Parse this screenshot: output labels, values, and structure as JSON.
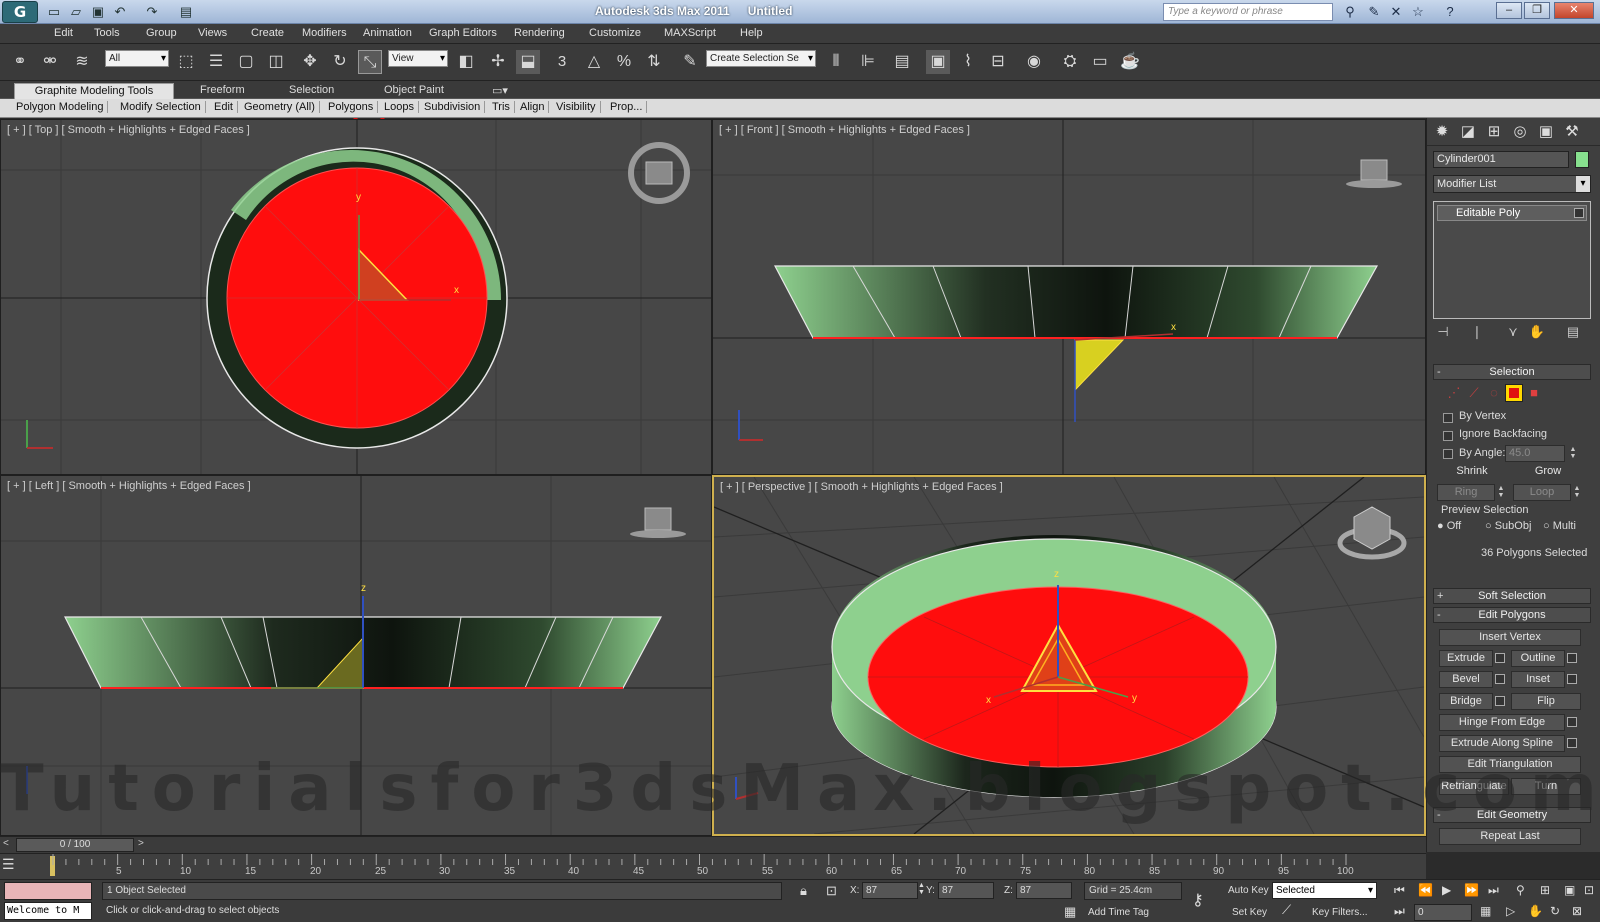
{
  "window": {
    "app_name": "Autodesk 3ds Max  2011",
    "doc_name": "Untitled",
    "search_placeholder": "Type a keyword or phrase"
  },
  "menu": [
    "Edit",
    "Tools",
    "Group",
    "Views",
    "Create",
    "Modifiers",
    "Animation",
    "Graph Editors",
    "Rendering",
    "Customize",
    "MAXScript",
    "Help"
  ],
  "toolbar": {
    "selection_filter": "All",
    "ref_coord": "View",
    "named_selection": "Create Selection Se",
    "snap_label": "3",
    "highlighted_tool": "scale-tool"
  },
  "ribbon": {
    "tabs": [
      "Graphite Modeling Tools",
      "Freeform",
      "Selection",
      "Object Paint"
    ],
    "sub": [
      "Polygon Modeling",
      "Modify Selection",
      "Edit",
      "Geometry (All)",
      "Polygons",
      "Loops",
      "Subdivision",
      "Tris",
      "Align",
      "Visibility",
      "Prop..."
    ]
  },
  "viewports": {
    "top": "[ + ] [ Top ] [ Smooth + Highlights + Edged Faces ]",
    "front": "[ + ] [ Front ] [ Smooth + Highlights + Edged Faces ]",
    "left": "[ + ] [ Left ] [ Smooth + Highlights + Edged Faces ]",
    "perspective": "[ + ] [ Perspective ] [ Smooth + Highlights + Edged Faces ]"
  },
  "command_panel": {
    "object_name": "Cylinder001",
    "object_color": "#87e08e",
    "modifier_list": "Modifier List",
    "stack_item": "Editable Poly",
    "selection": {
      "title": "Selection",
      "by_vertex": "By Vertex",
      "ignore_backfacing": "Ignore Backfacing",
      "by_angle": "By Angle:",
      "angle_value": "45.0",
      "shrink": "Shrink",
      "grow": "Grow",
      "ring": "Ring",
      "loop": "Loop",
      "preview": "Preview Selection",
      "off": "Off",
      "subobj": "SubObj",
      "multi": "Multi",
      "status": "36 Polygons Selected"
    },
    "soft_selection": "Soft Selection",
    "edit_polygons": {
      "title": "Edit Polygons",
      "insert_vertex": "Insert Vertex",
      "extrude": "Extrude",
      "outline": "Outline",
      "bevel": "Bevel",
      "inset": "Inset",
      "bridge": "Bridge",
      "flip": "Flip",
      "hinge": "Hinge From Edge",
      "extrude_spline": "Extrude Along Spline",
      "edit_tri": "Edit Triangulation",
      "retriangulate": "Retriangulate",
      "turn": "Turn"
    },
    "edit_geometry": "Edit Geometry",
    "repeat_last": "Repeat Last"
  },
  "timeline": {
    "slider": "0 / 100",
    "ticks": [
      "5",
      "10",
      "15",
      "20",
      "25",
      "30",
      "35",
      "40",
      "45",
      "50",
      "55",
      "60",
      "65",
      "70",
      "75",
      "80",
      "85",
      "90",
      "95",
      "100"
    ]
  },
  "status": {
    "selected": "1 Object Selected",
    "prompt": "Click or click-and-drag to select objects",
    "maxscript": "Welcome to M",
    "x_label": "X:",
    "x_value": "87",
    "y_label": "Y:",
    "y_value": "87",
    "z_label": "Z:",
    "z_value": "87",
    "grid": "Grid = 25.4cm",
    "add_time_tag": "Add Time Tag",
    "auto_key": "Auto Key",
    "set_key": "Set Key",
    "key_mode": "Selected",
    "key_filters": "Key Filters...",
    "frame": "0"
  },
  "watermark": "Tutorialsfor3dsMax.blogspot.com",
  "colors": {
    "selected_face": "#ff0d0d",
    "mesh_light": "#8ed08e",
    "mesh_dark": "#121a12",
    "accent_border": "#cfb04e"
  }
}
